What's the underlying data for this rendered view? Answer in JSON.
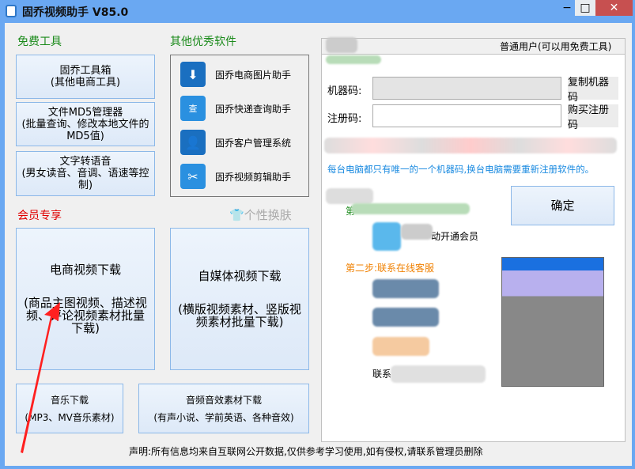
{
  "window": {
    "title": "固乔视频助手 V85.0",
    "minimize": "−",
    "maximize": "□",
    "close": "✕"
  },
  "free_tools": {
    "heading": "免费工具",
    "buttons": [
      {
        "line1": "固乔工具箱",
        "line2": "(其他电商工具)"
      },
      {
        "line1": "文件MD5管理器",
        "line2": "(批量查询、修改本地文件的MD5值)"
      },
      {
        "line1": "文字转语音",
        "line2": "(男女读音、音调、语速等控制)"
      }
    ]
  },
  "other_software": {
    "heading": "其他优秀软件",
    "items": [
      {
        "label": "固乔电商图片助手",
        "icon": "download-icon",
        "glyph": "⬇"
      },
      {
        "label": "固乔快递查询助手",
        "icon": "express-search-icon",
        "glyph": "查"
      },
      {
        "label": "固乔客户管理系统",
        "icon": "customer-icon",
        "glyph": "👤"
      },
      {
        "label": "固乔视频剪辑助手",
        "icon": "scissors-icon",
        "glyph": "✂"
      }
    ]
  },
  "vip": {
    "heading": "会员专享",
    "skin": "个性换肤",
    "skin_icon": "👕",
    "ecom": {
      "title": "电商视频下载",
      "desc": "(商品主图视频、描述视频、评论视频素材批量下载)"
    },
    "media": {
      "title": "自媒体视频下载",
      "desc": "(横版视频素材、竖版视频素材批量下载)"
    },
    "music": {
      "title": "音乐下载",
      "desc": "(MP3、MV音乐素材)"
    },
    "audio": {
      "title": "音频音效素材下载",
      "desc": "(有声小说、学前英语、各种音效)"
    }
  },
  "register": {
    "user_type": "普通用户(可以用免费工具)",
    "machine_label": "机器码:",
    "machine_value": "",
    "copy_button": "复制机器码",
    "reg_label": "注册码:",
    "reg_value": "",
    "buy_button": "购买注册码",
    "notice": "每台电脑都只有唯一的一个机器码,换台电脑需要重新注册软件的。",
    "confirm": "确定",
    "step1_partial": "第",
    "open_vip_partial": "动开通会员",
    "step2": "第二步:联系在线客服",
    "contact_partial": "联系"
  },
  "footer": {
    "statement": "声明:所有信息均来自互联网公开数据,仅供参考学习使用,如有侵权,请联系管理员删除"
  },
  "colors": {
    "titlebar": "#6aa8f2",
    "close": "#c75050",
    "green": "#1a8a1a",
    "red": "#e00000",
    "orange": "#f08000",
    "blue_text": "#1a8ae0"
  }
}
